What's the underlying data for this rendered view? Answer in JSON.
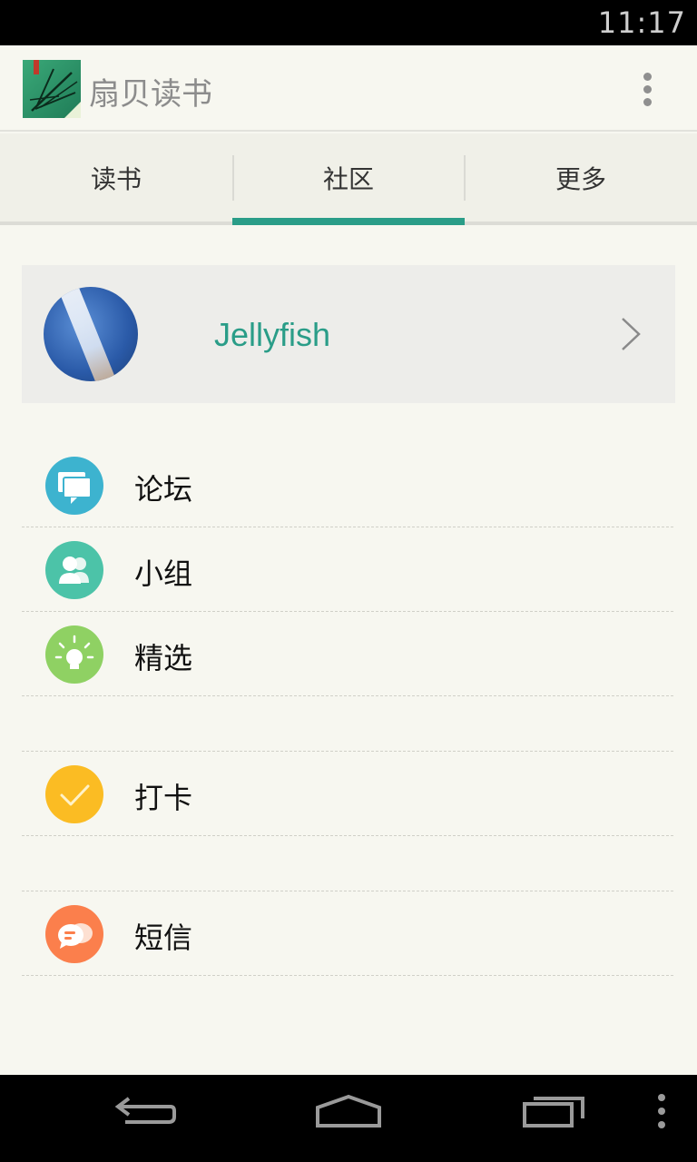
{
  "status_bar": {
    "time": "11:17"
  },
  "app_bar": {
    "title": "扇贝读书",
    "logo_icon": "bamboo-book-logo",
    "overflow_icon": "more-vertical-icon"
  },
  "tabs": [
    {
      "label": "读书",
      "selected": false
    },
    {
      "label": "社区",
      "selected": true
    },
    {
      "label": "更多",
      "selected": false
    }
  ],
  "accent_color": "#2a9d88",
  "profile": {
    "name": "Jellyfish",
    "chevron_icon": "chevron-right-icon"
  },
  "menu": {
    "forum": {
      "label": "论坛",
      "icon": "forum-icon",
      "color": "#3db3cf"
    },
    "group": {
      "label": "小组",
      "icon": "group-icon",
      "color": "#4cc3a8"
    },
    "featured": {
      "label": "精选",
      "icon": "lightbulb-icon",
      "color": "#8fd163"
    },
    "checkin": {
      "label": "打卡",
      "icon": "check-icon",
      "color": "#fbbc23"
    },
    "messages": {
      "label": "短信",
      "icon": "message-icon",
      "color": "#fb7f4c"
    }
  },
  "nav_bar": {
    "back_icon": "back-icon",
    "home_icon": "home-icon",
    "recents_icon": "recents-icon",
    "menu_icon": "more-vertical-icon"
  }
}
